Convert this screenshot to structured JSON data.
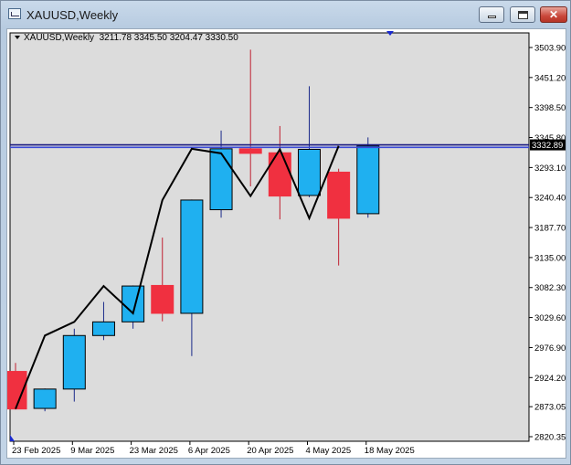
{
  "window": {
    "title": "XAUUSD,Weekly"
  },
  "chart_header": {
    "symbol": "XAUUSD,Weekly",
    "ohlc": "3211.78 3345.50 3204.47 3330.50"
  },
  "chart_data": {
    "type": "candlestick",
    "price_axis": [
      "3503.90",
      "3451.20",
      "3398.50",
      "3345.80",
      "3293.10",
      "3240.40",
      "3187.70",
      "3135.00",
      "3082.30",
      "3029.60",
      "2976.90",
      "2924.20",
      "2873.05",
      "2820.35"
    ],
    "price_range": [
      2820.35,
      3503.9
    ],
    "current_price_label": "3332.89",
    "current_price": 3332.89,
    "date_labels": [
      "23 Feb 2025",
      "9 Mar 2025",
      "23 Mar 2025",
      "6 Apr 2025",
      "20 Apr 2025",
      "4 May 2025",
      "18 May 2025"
    ],
    "candles": [
      {
        "open": 2935,
        "high": 2950,
        "low": 2868,
        "close": 2869
      },
      {
        "open": 2870,
        "high": 2905,
        "low": 2865,
        "close": 2904
      },
      {
        "open": 2904,
        "high": 3010,
        "low": 2882,
        "close": 2998
      },
      {
        "open": 2998,
        "high": 3057,
        "low": 2990,
        "close": 3022
      },
      {
        "open": 3022,
        "high": 3086,
        "low": 3010,
        "close": 3085
      },
      {
        "open": 3086,
        "high": 3170,
        "low": 3023,
        "close": 3037
      },
      {
        "open": 3037,
        "high": 3237,
        "low": 2962,
        "close": 3236
      },
      {
        "open": 3219,
        "high": 3358,
        "low": 3205,
        "close": 3326
      },
      {
        "open": 3326,
        "high": 3500,
        "low": 3260,
        "close": 3318
      },
      {
        "open": 3319,
        "high": 3366,
        "low": 3202,
        "close": 3243
      },
      {
        "open": 3244,
        "high": 3436,
        "low": 3241,
        "close": 3325
      },
      {
        "open": 3285,
        "high": 3291,
        "low": 3121,
        "close": 3204
      },
      {
        "open": 3212,
        "high": 3346,
        "low": 3205,
        "close": 3331
      }
    ],
    "zigzag": [
      2869,
      2998,
      3022,
      3085,
      3037,
      3236,
      3326,
      3318,
      3243,
      3325,
      3204,
      3331
    ],
    "horizontal_lines": [
      {
        "price": 3332.89,
        "color": "#1a1a80"
      },
      {
        "price": 3328.5,
        "color": "#3a4ad8"
      }
    ],
    "colors": {
      "bull": "#1fb0f0",
      "bear": "#f03040",
      "grid": "#d9d9d9",
      "zigzag": "#000000"
    }
  }
}
